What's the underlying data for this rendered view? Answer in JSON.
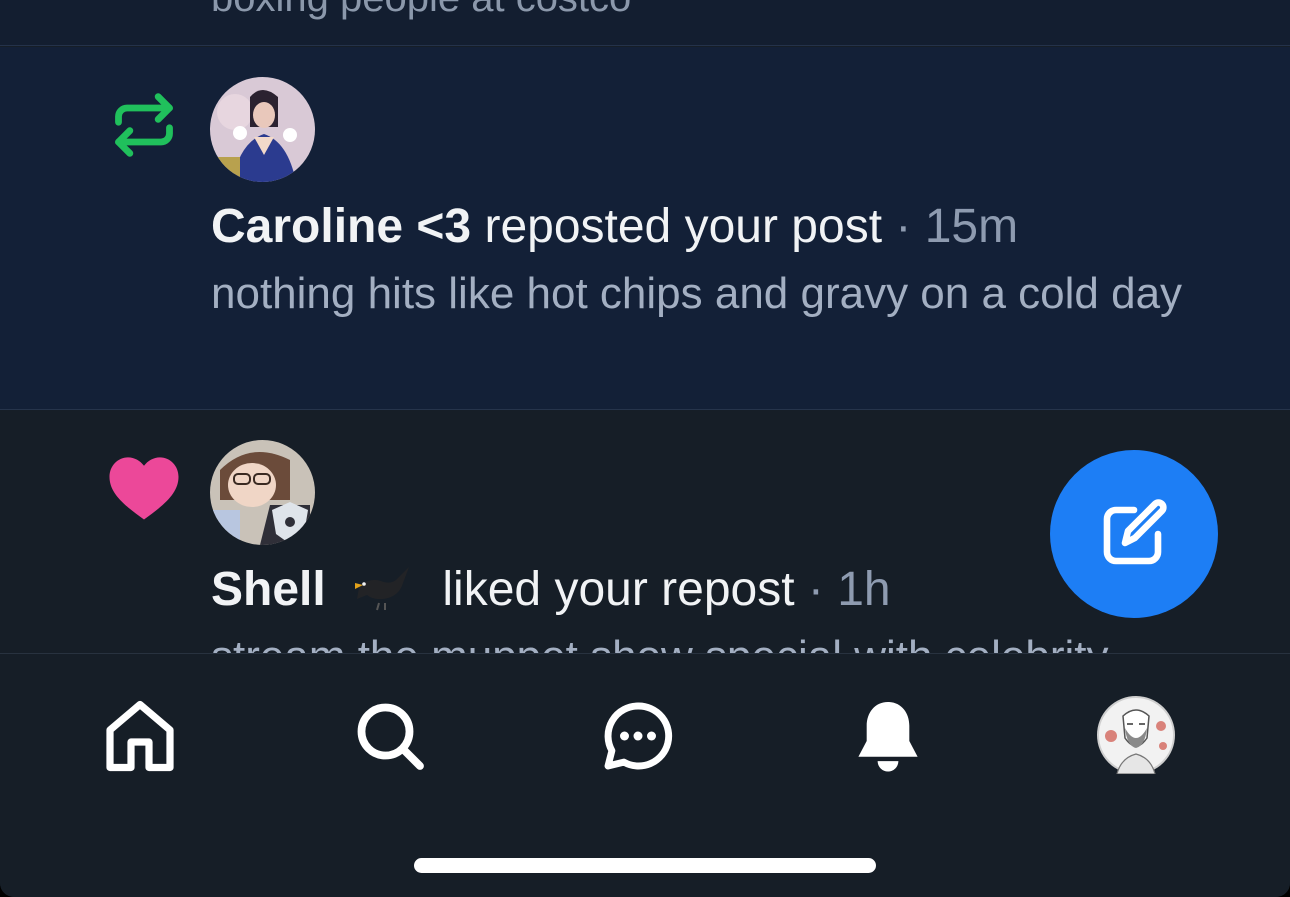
{
  "previous_item": {
    "snippet": "boxing people at costco"
  },
  "notifications": [
    {
      "type": "repost",
      "icon": "repost-icon",
      "icon_color": "#20c05c",
      "author": "Caroline <3",
      "action": "reposted your post",
      "separator": "·",
      "time": "15m",
      "post_text": "nothing hits like hot chips and gravy on a cold day",
      "unread": true
    },
    {
      "type": "like",
      "icon": "heart-icon",
      "icon_color": "#ec4899",
      "author": "Shell",
      "author_emoji": "blackbird-emoji",
      "action": "liked your repost",
      "separator": "·",
      "time": "1h",
      "post_text": "stream the muppet show special with celebrity",
      "unread": false
    }
  ],
  "compose_button": {
    "icon": "compose-icon",
    "color": "#1d7ef5"
  },
  "tab_bar": {
    "items": [
      {
        "name": "home",
        "icon": "home-icon"
      },
      {
        "name": "search",
        "icon": "search-icon"
      },
      {
        "name": "messages",
        "icon": "chat-bubble-icon"
      },
      {
        "name": "notifications",
        "icon": "bell-icon",
        "active": true
      },
      {
        "name": "profile",
        "icon": "avatar"
      }
    ]
  },
  "colors": {
    "background": "#161e27",
    "unread_background": "#132037",
    "primary_text": "#f1f3f5",
    "secondary_text": "#a3afc2",
    "accent": "#1d7ef5"
  }
}
